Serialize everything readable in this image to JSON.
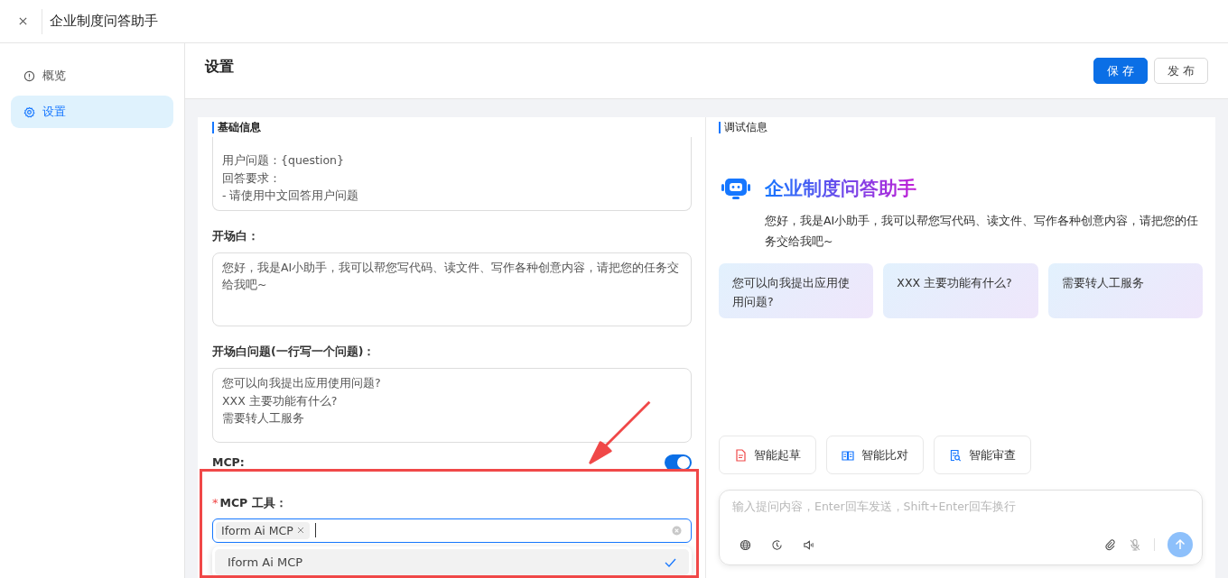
{
  "app": {
    "title": "企业制度问答助手"
  },
  "sidebar": {
    "items": [
      {
        "label": "概览",
        "selected": false
      },
      {
        "label": "设置",
        "selected": true
      }
    ]
  },
  "header": {
    "title": "设置",
    "buttons": [
      {
        "label": "保 存",
        "kind": "primary"
      },
      {
        "label": "发 布",
        "kind": "default"
      }
    ]
  },
  "settings": {
    "section_title": "基础信息",
    "prompt_lines": [
      "用户问题：{question}",
      "回答要求：",
      "- 请使用中文回答用户问题"
    ],
    "opening": {
      "label": "开场白：",
      "value": "您好，我是AI小助手，我可以帮您写代码、读文件、写作各种创意内容，请把您的任务交给我吧~"
    },
    "opening_questions": {
      "label": "开场白问题(一行写一个问题)：",
      "lines": [
        "您可以向我提出应用使用问题?",
        "XXX 主要功能有什么?",
        "需要转人工服务"
      ]
    },
    "mcp": {
      "label": "MCP:",
      "on": true
    },
    "mcp_tools": {
      "required_mark": "*",
      "label": "MCP 工具：",
      "tags": [
        "Iform Ai MCP"
      ],
      "options": [
        {
          "label": "Iform Ai MCP",
          "selected": true
        }
      ]
    }
  },
  "debug": {
    "section_title": "调试信息",
    "bot_name": "企业制度问答助手",
    "greeting": "您好，我是AI小助手，我可以帮您写代码、读文件、写作各种创意内容，请把您的任务交给我吧~",
    "suggestions": [
      "您可以向我提出应用使用问题?",
      "XXX 主要功能有什么?",
      "需要转人工服务"
    ],
    "skills": [
      {
        "label": "智能起草"
      },
      {
        "label": "智能比对"
      },
      {
        "label": "智能审查"
      }
    ],
    "input": {
      "placeholder": "输入提问内容，Enter回车发送，Shift+Enter回车换行"
    }
  }
}
